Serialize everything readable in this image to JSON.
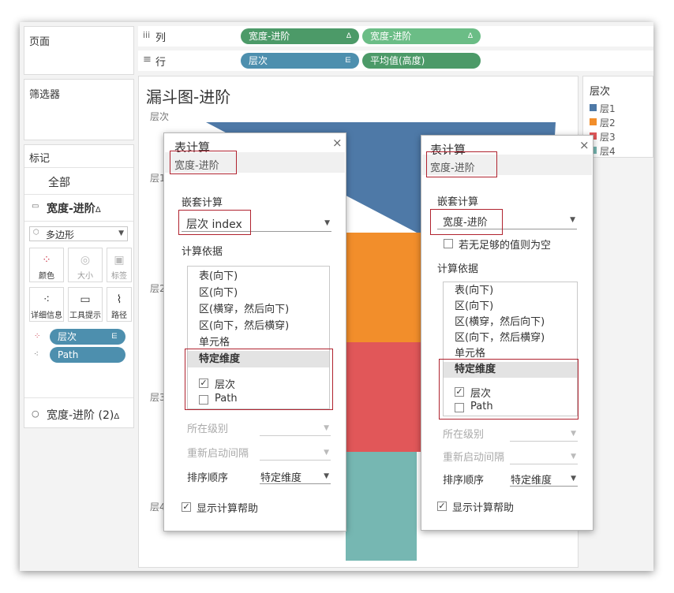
{
  "shelves": {
    "pages_label": "页面",
    "filters_label": "筛选器",
    "columns_icon": "iii",
    "columns_label": "列",
    "rows_icon": "≡",
    "rows_label": "行",
    "columns_pills": [
      "宽度-进阶",
      "宽度-进阶"
    ],
    "columns_pill_marker": "Δ",
    "rows_pills": [
      "层次",
      "平均值(高度)"
    ],
    "rows_pill_marker": "⋿"
  },
  "marks": {
    "label": "标记",
    "all": "全部",
    "card1": "宽度-进阶",
    "delta": "Δ",
    "mark_type": "多边形",
    "buttons": [
      "颜色",
      "大小",
      "标签",
      "详细信息",
      "工具提示",
      "路径"
    ],
    "fields": [
      "层次",
      "Path"
    ],
    "card2": "宽度-进阶 (2)"
  },
  "sheet": {
    "title": "漏斗图-进阶",
    "axis_header": "层次",
    "row_labels": [
      "层1",
      "层2",
      "层3",
      "层4"
    ]
  },
  "legend": {
    "title": "层次",
    "items": [
      {
        "label": "层1",
        "color": "#4e79a7"
      },
      {
        "label": "层2",
        "color": "#f28e2b"
      },
      {
        "label": "层3",
        "color": "#e15759"
      },
      {
        "label": "层4",
        "color": "#76b7b2"
      }
    ]
  },
  "dialog_left": {
    "title": "表计算",
    "subtitle": "宽度-进阶",
    "close": "×",
    "nested_label": "嵌套计算",
    "nested_value": "层次 index",
    "compute_label": "计算依据",
    "options": [
      "表(向下)",
      "区(向下)",
      "区(横穿，然后向下)",
      "区(向下，然后横穿)",
      "单元格"
    ],
    "specific_header": "特定维度",
    "dims": [
      {
        "label": "层次",
        "checked": "✓"
      },
      {
        "label": "Path",
        "checked": ""
      }
    ],
    "level_label": "所在级别",
    "restart_label": "重新启动间隔",
    "sort_label": "排序顺序",
    "sort_value": "特定维度",
    "help_label": "显示计算帮助",
    "help_checked": "✓"
  },
  "dialog_right": {
    "title": "表计算",
    "subtitle": "宽度-进阶",
    "close": "×",
    "nested_label": "嵌套计算",
    "nested_value": "宽度-进阶",
    "null_label": "若无足够的值则为空",
    "compute_label": "计算依据",
    "options": [
      "表(向下)",
      "区(向下)",
      "区(横穿，然后向下)",
      "区(向下，然后横穿)",
      "单元格"
    ],
    "specific_header": "特定维度",
    "dims": [
      {
        "label": "层次",
        "checked": "✓"
      },
      {
        "label": "Path",
        "checked": ""
      }
    ],
    "level_label": "所在级别",
    "restart_label": "重新启动间隔",
    "sort_label": "排序顺序",
    "sort_value": "特定维度",
    "help_label": "显示计算帮助",
    "help_checked": "✓"
  }
}
